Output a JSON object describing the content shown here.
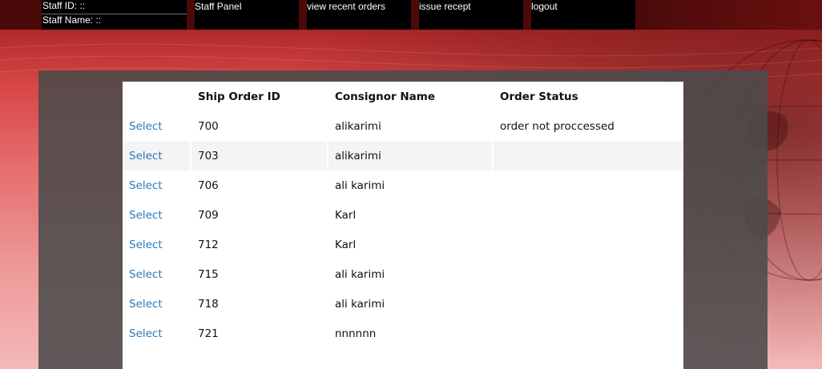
{
  "header": {
    "staff_id_label": "Staff ID: ::",
    "staff_name_label": "Staff Name: ::",
    "nav": [
      {
        "label": "Staff Panel"
      },
      {
        "label": "view recent orders"
      },
      {
        "label": "issue recept"
      },
      {
        "label": "logout"
      }
    ]
  },
  "orders_table": {
    "columns": [
      "",
      "Ship Order ID",
      "Consignor Name",
      "Order Status"
    ],
    "rows": [
      {
        "action": "Select",
        "id": "700",
        "consignor": "alikarimi",
        "status": "order not proccessed"
      },
      {
        "action": "Select",
        "id": "703",
        "consignor": "alikarimi",
        "status": ""
      },
      {
        "action": "Select",
        "id": "706",
        "consignor": "ali karimi",
        "status": ""
      },
      {
        "action": "Select",
        "id": "709",
        "consignor": "Karl",
        "status": ""
      },
      {
        "action": "Select",
        "id": "712",
        "consignor": "Karl",
        "status": ""
      },
      {
        "action": "Select",
        "id": "715",
        "consignor": "ali karimi",
        "status": ""
      },
      {
        "action": "Select",
        "id": "718",
        "consignor": "ali karimi",
        "status": ""
      },
      {
        "action": "Select",
        "id": "721",
        "consignor": "nnnnnn",
        "status": ""
      }
    ]
  },
  "colors": {
    "link": "#2a78b8",
    "nav_background": "#000000",
    "topbar": "#4a0a0a",
    "panel": "#4b4b4b"
  }
}
